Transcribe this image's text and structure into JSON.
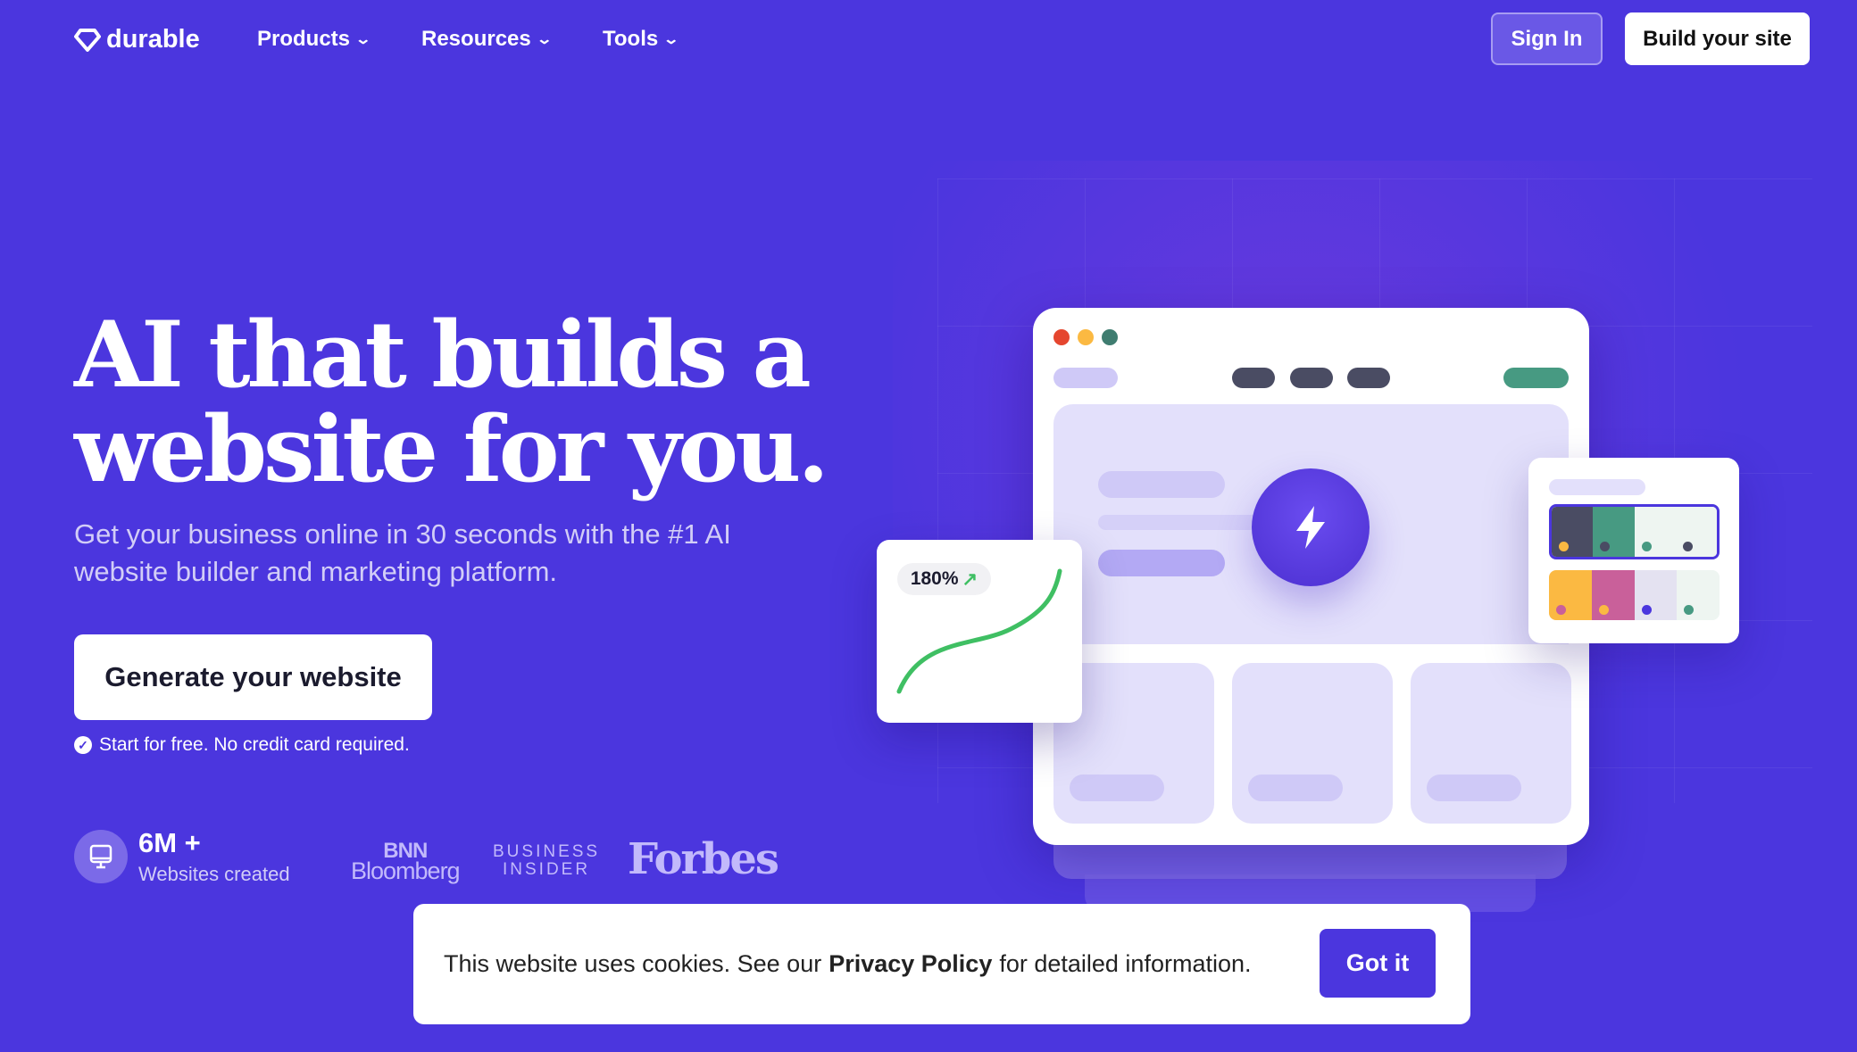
{
  "nav": {
    "logo": "durable",
    "items": [
      {
        "label": "Products"
      },
      {
        "label": "Resources"
      },
      {
        "label": "Tools"
      }
    ],
    "sign_in": "Sign In",
    "build": "Build your site"
  },
  "hero": {
    "title_line1": "AI that builds a",
    "title_line2": "website for you.",
    "subtitle": "Get your business online in 30 seconds with the #1 AI website builder and marketing platform.",
    "cta": "Generate your website",
    "note": "Start for free. No credit card required."
  },
  "stats": {
    "value": "6M +",
    "label": "Websites created",
    "icon": "monitor-icon"
  },
  "press": {
    "bnn_1": "BNN",
    "bnn_2": "Bloomberg",
    "bi_1": "BUSINESS",
    "bi_2": "INSIDER",
    "forbes": "Forbes"
  },
  "illustration": {
    "growth": "180%",
    "colors": {
      "red": "#e5462f",
      "yellow": "#fbb942",
      "teal": "#3f7d70",
      "dark": "#4a4c63",
      "green": "#479a82"
    }
  },
  "cookie": {
    "text_before": "This website uses cookies. See our",
    "link": "Privacy Policy",
    "text_after": "for detailed information.",
    "button": "Got it"
  }
}
